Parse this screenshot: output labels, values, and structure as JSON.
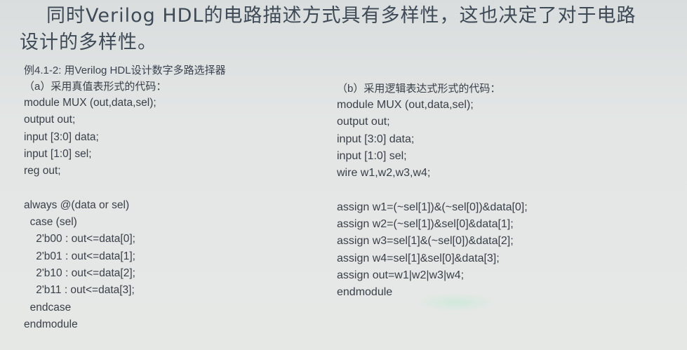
{
  "intro": {
    "line1": "同时Verilog HDL的电路描述方式具有多样性，这也决定了对于电路",
    "line2": "设计的多样性。"
  },
  "example_title": "例4.1-2: 用Verilog HDL设计数字多路选择器",
  "left": {
    "subhead": "（a）采用真值表形式的代码：",
    "code": [
      "module MUX (out,data,sel);",
      "output out;",
      "input [3:0] data;",
      "input [1:0] sel;",
      "reg out;",
      "",
      "always @(data or sel)",
      "  case (sel)",
      "    2'b00 : out<=data[0];",
      "    2'b01 : out<=data[1];",
      "    2'b10 : out<=data[2];",
      "    2'b11 : out<=data[3];",
      "  endcase",
      "endmodule"
    ]
  },
  "right": {
    "subhead": "（b）采用逻辑表达式形式的代码：",
    "code": [
      "module MUX (out,data,sel);",
      "output out;",
      "input [3:0] data;",
      "input [1:0] sel;",
      "wire w1,w2,w3,w4;",
      "",
      "assign w1=(~sel[1])&(~sel[0])&data[0];",
      "assign w2=(~sel[1])&sel[0]&data[1];",
      "assign w3=sel[1]&(~sel[0])&data[2];",
      "assign w4=sel[1]&sel[0]&data[3];",
      "assign out=w1|w2|w3|w4;",
      "endmodule"
    ]
  }
}
